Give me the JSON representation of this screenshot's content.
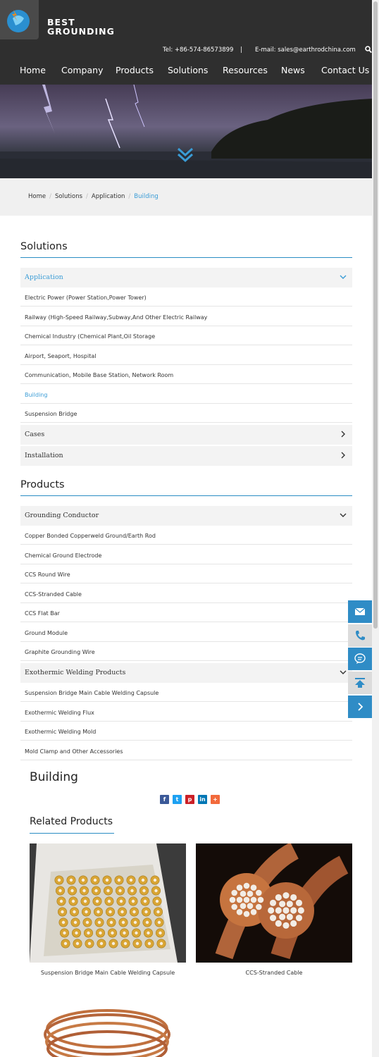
{
  "header": {
    "brand_line1": "BEST",
    "brand_line2": "GROUNDING",
    "tel": "Tel: +86-574-86573899",
    "separator": "|",
    "email": "E-mail: sales@earthrodchina.com",
    "nav": [
      "Home",
      "Company",
      "Products",
      "Solutions",
      "Resources",
      "News",
      "Contact Us"
    ]
  },
  "breadcrumb": [
    "Home",
    "Solutions",
    "Application",
    "Building"
  ],
  "solutions": {
    "title": "Solutions",
    "open_category": "Application",
    "items": [
      "Electric Power (Power Station,Power Tower)",
      "Railway (High-Speed Railway,Subway,And Other Electric Railway",
      "Chemical Industry (Chemical Plant,Oil Storage",
      "Airport, Seaport, Hospital",
      "Communication, Mobile Base Station, Network Room",
      "Building",
      "Suspension Bridge"
    ],
    "other_categories": [
      "Cases",
      "Installation"
    ]
  },
  "products": {
    "title": "Products",
    "cat1": "Grounding Conductor",
    "cat1_items": [
      "Copper Bonded Copperweld Ground/Earth Rod",
      "Chemical Ground Electrode",
      "CCS Round Wire",
      "CCS-Stranded Cable",
      "CCS Flat Bar",
      "Ground Module",
      "Graphite Grounding Wire"
    ],
    "cat2": "Exothermic Welding Products",
    "cat2_items": [
      "Suspension Bridge Main Cable Welding Capsule",
      "Exothermic Welding Flux",
      "Exothermic Welding Mold",
      "Mold Clamp and Other Accessories"
    ]
  },
  "content": {
    "page_title": "Building",
    "share_icons": [
      "facebook-icon",
      "twitter-icon",
      "pinterest-icon",
      "linkedin-icon",
      "more-share-icon"
    ],
    "related_title": "Related Products",
    "related": [
      "Suspension Bridge Main Cable Welding Capsule",
      "CCS-Stranded Cable"
    ]
  },
  "colors": {
    "accent": "#3a9cd6",
    "header_bg": "#2f2f2f",
    "tool_bg": "#2f8cc6"
  },
  "floating_tools": [
    "mail-icon",
    "phone-icon",
    "chat-icon",
    "back-to-top-icon",
    "chevron-right-icon"
  ]
}
